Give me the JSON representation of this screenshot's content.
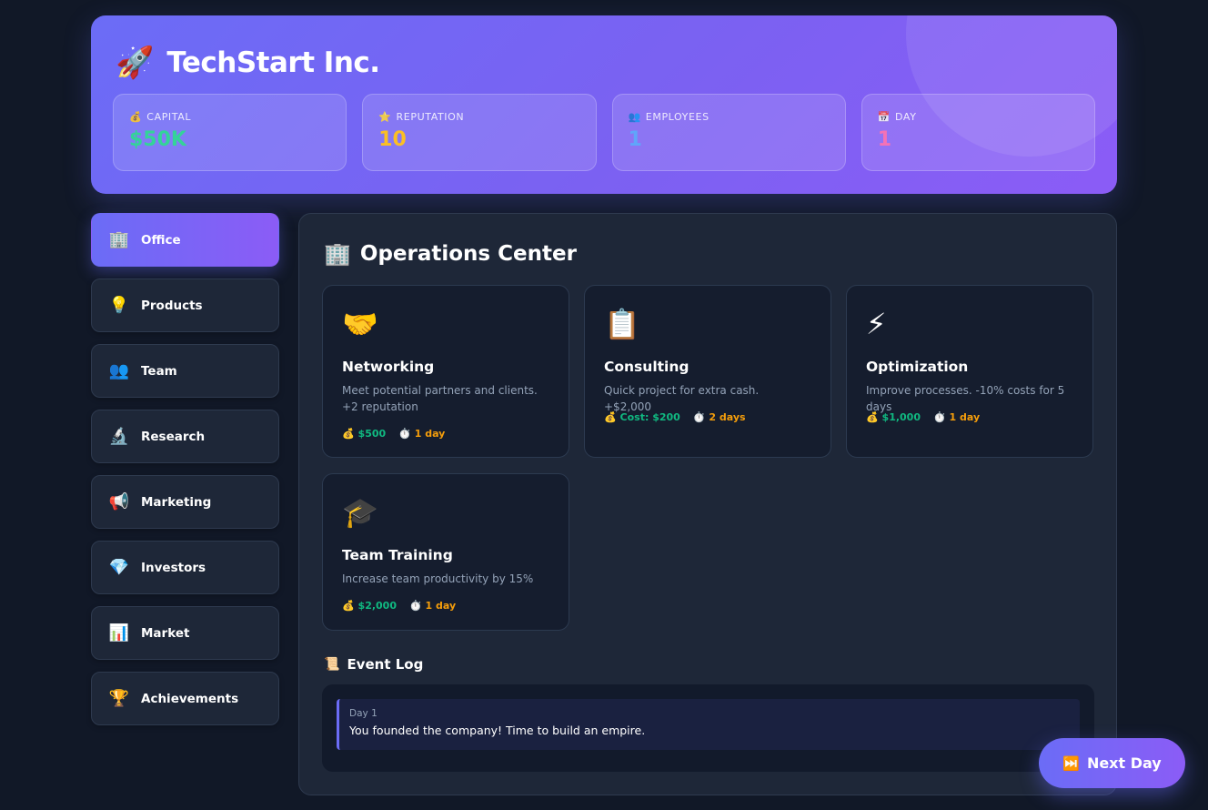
{
  "header": {
    "icon": "rocket-icon",
    "icon_glyph": "🚀",
    "company_name": "TechStart Inc.",
    "stats": [
      {
        "label": "CAPITAL",
        "value": "$50K",
        "icon": "money-bag-icon",
        "icon_glyph": "💰",
        "color": "#34d399"
      },
      {
        "label": "REPUTATION",
        "value": "10",
        "icon": "star-icon",
        "icon_glyph": "⭐",
        "color": "#fbbf24"
      },
      {
        "label": "EMPLOYEES",
        "value": "1",
        "icon": "people-icon",
        "icon_glyph": "👥",
        "color": "#60a5fa"
      },
      {
        "label": "DAY",
        "value": "1",
        "icon": "calendar-icon",
        "icon_glyph": "📅",
        "color": "#f472b6"
      }
    ]
  },
  "sidebar": {
    "items": [
      {
        "label": "Office",
        "icon": "office-building-icon",
        "icon_glyph": "🏢",
        "active": true
      },
      {
        "label": "Products",
        "icon": "lightbulb-icon",
        "icon_glyph": "💡",
        "active": false
      },
      {
        "label": "Team",
        "icon": "people-icon",
        "icon_glyph": "👥",
        "active": false
      },
      {
        "label": "Research",
        "icon": "microscope-icon",
        "icon_glyph": "🔬",
        "active": false
      },
      {
        "label": "Marketing",
        "icon": "megaphone-icon",
        "icon_glyph": "📢",
        "active": false
      },
      {
        "label": "Investors",
        "icon": "gem-icon",
        "icon_glyph": "💎",
        "active": false
      },
      {
        "label": "Market",
        "icon": "bar-chart-icon",
        "icon_glyph": "📊",
        "active": false
      },
      {
        "label": "Achievements",
        "icon": "trophy-icon",
        "icon_glyph": "🏆",
        "active": false
      }
    ]
  },
  "main": {
    "title": "Operations Center",
    "title_icon": "office-building-icon",
    "title_icon_glyph": "🏢",
    "actions": [
      {
        "name": "Networking",
        "icon": "handshake-icon",
        "icon_glyph": "🤝",
        "description": "Meet potential partners and clients. +2 reputation",
        "cost": "$500",
        "cost_icon_glyph": "💰",
        "time": "1 day",
        "time_icon_glyph": "⏱️"
      },
      {
        "name": "Consulting",
        "icon": "clipboard-icon",
        "icon_glyph": "📋",
        "description": "Quick project for extra cash. +$2,000",
        "cost": "Cost: $200",
        "cost_icon_glyph": "💰",
        "time": "2 days",
        "time_icon_glyph": "⏱️"
      },
      {
        "name": "Optimization",
        "icon": "lightning-icon",
        "icon_glyph": "⚡",
        "description": "Improve processes. -10% costs for 5 days",
        "cost": "$1,000",
        "cost_icon_glyph": "💰",
        "time": "1 day",
        "time_icon_glyph": "⏱️"
      },
      {
        "name": "Team Training",
        "icon": "graduation-cap-icon",
        "icon_glyph": "🎓",
        "description": "Increase team productivity by 15%",
        "cost": "$2,000",
        "cost_icon_glyph": "💰",
        "time": "1 day",
        "time_icon_glyph": "⏱️"
      }
    ],
    "event_log": {
      "title": "Event Log",
      "icon": "scroll-icon",
      "icon_glyph": "📜",
      "entries": [
        {
          "day": "Day 1",
          "message": "You founded the company! Time to build an empire."
        }
      ]
    }
  },
  "next_day_button": {
    "label": "Next Day",
    "icon": "fast-forward-icon",
    "icon_glyph": "⏭️"
  }
}
